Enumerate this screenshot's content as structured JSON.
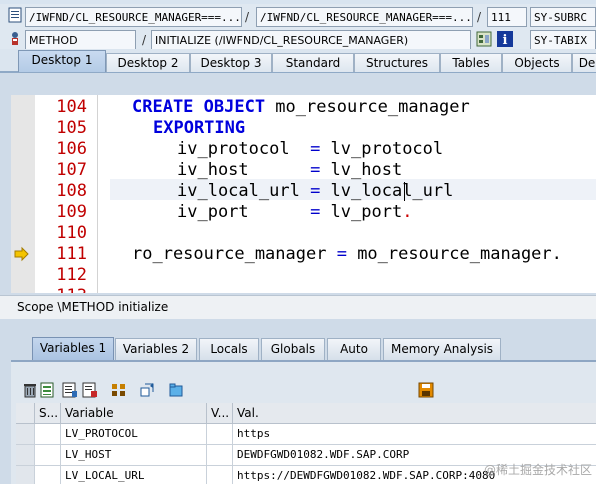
{
  "header": {
    "row1": {
      "program": "/IWFND/CL_RESOURCE_MANAGER===...",
      "include": "/IWFND/CL_RESOURCE_MANAGER===...",
      "line": "111",
      "sysfield": "SY-SUBRC"
    },
    "row2": {
      "event_type": "METHOD",
      "event": "INITIALIZE (/IWFND/CL_RESOURCE_MANAGER)",
      "sysfield": "SY-TABIX"
    },
    "separator": "/"
  },
  "desktop_tabs": [
    "Desktop 1",
    "Desktop 2",
    "Desktop 3",
    "Standard",
    "Structures",
    "Tables",
    "Objects",
    "De"
  ],
  "active_desktop_tab": "Desktop 1",
  "editor": {
    "line_numbers": [
      "104",
      "105",
      "106",
      "107",
      "108",
      "109",
      "110",
      "111",
      "112"
    ],
    "current_line": "111",
    "highlighted_line": "108"
  },
  "scope": "Scope \\METHOD initialize",
  "variable_tabs": [
    "Variables 1",
    "Variables 2",
    "Locals",
    "Globals",
    "Auto",
    "Memory Analysis"
  ],
  "active_variable_tab": "Variables 1",
  "table": {
    "columns": [
      "S...",
      "Variable",
      "V...",
      "Val."
    ],
    "rows": [
      {
        "variable": "LV_PROTOCOL",
        "value": "https"
      },
      {
        "variable": "LV_HOST",
        "value": "DEWDFGWD01082.WDF.SAP.CORP"
      },
      {
        "variable": "LV_LOCAL_URL",
        "value": "https://DEWDFGWD01082.WDF.SAP.CORP:4080"
      }
    ]
  },
  "watermark": "@稀土掘金技术社区",
  "icons": [
    "document-icon",
    "debugger-icon",
    "struct-icon",
    "info-icon",
    "delete-icon",
    "layout-icon",
    "save-icon"
  ]
}
